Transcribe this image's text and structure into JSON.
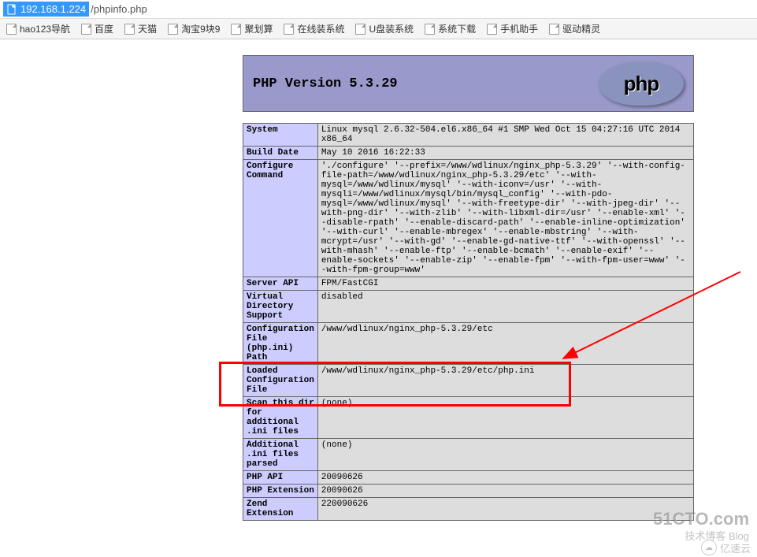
{
  "url": {
    "highlighted": "192.168.1.224",
    "rest": "/phpinfo.php"
  },
  "bookmarks": [
    "hao123导航",
    "百度",
    "天猫",
    "淘宝9块9",
    "聚划算",
    "在线装系统",
    "U盘装系统",
    "系统下载",
    "手机助手",
    "驱动精灵"
  ],
  "header": {
    "title": "PHP Version 5.3.29",
    "logo_text": "php"
  },
  "rows": [
    {
      "label": "System",
      "value": "Linux mysql 2.6.32-504.el6.x86_64 #1 SMP Wed Oct 15 04:27:16 UTC 2014 x86_64"
    },
    {
      "label": "Build Date",
      "value": "May 10 2016 16:22:33"
    },
    {
      "label": "Configure Command",
      "value": "'./configure' '--prefix=/www/wdlinux/nginx_php-5.3.29' '--with-config-file-path=/www/wdlinux/nginx_php-5.3.29/etc' '--with-mysql=/www/wdlinux/mysql' '--with-iconv=/usr' '--with-mysqli=/www/wdlinux/mysql/bin/mysql_config' '--with-pdo-mysql=/www/wdlinux/mysql' '--with-freetype-dir' '--with-jpeg-dir' '--with-png-dir' '--with-zlib' '--with-libxml-dir=/usr' '--enable-xml' '--disable-rpath' '--enable-discard-path' '--enable-inline-optimization' '--with-curl' '--enable-mbregex' '--enable-mbstring' '--with-mcrypt=/usr' '--with-gd' '--enable-gd-native-ttf' '--with-openssl' '--with-mhash' '--enable-ftp' '--enable-bcmath' '--enable-exif' '--enable-sockets' '--enable-zip' '--enable-fpm' '--with-fpm-user=www' '--with-fpm-group=www'"
    },
    {
      "label": "Server API",
      "value": "FPM/FastCGI"
    },
    {
      "label": "Virtual Directory Support",
      "value": "disabled"
    },
    {
      "label": "Configuration File (php.ini) Path",
      "value": "/www/wdlinux/nginx_php-5.3.29/etc"
    },
    {
      "label": "Loaded Configuration File",
      "value": "/www/wdlinux/nginx_php-5.3.29/etc/php.ini"
    },
    {
      "label": "Scan this dir for additional .ini files",
      "value": "(none)"
    },
    {
      "label": "Additional .ini files parsed",
      "value": "(none)"
    },
    {
      "label": "PHP API",
      "value": "20090626"
    },
    {
      "label": "PHP Extension",
      "value": "20090626"
    },
    {
      "label": "Zend Extension",
      "value": "220090626"
    }
  ],
  "watermarks": {
    "top": "51CTO.com",
    "sub": "技术博客 Blog",
    "yisu": "亿速云"
  }
}
